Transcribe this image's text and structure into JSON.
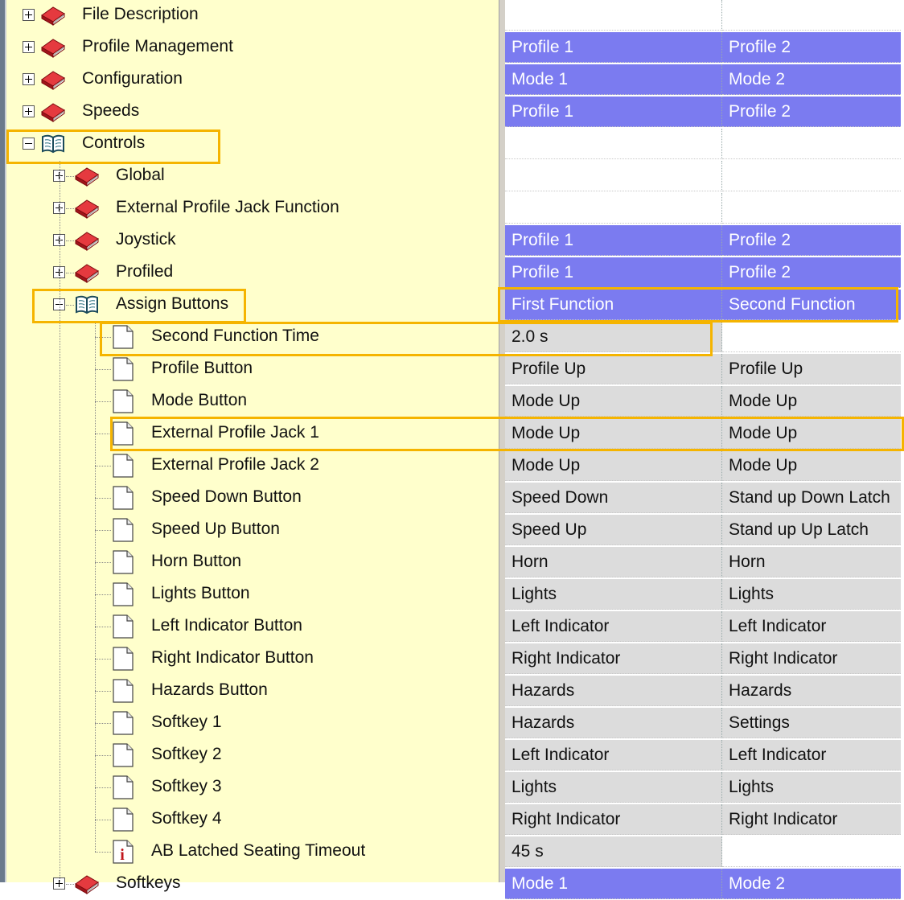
{
  "tree": [
    {
      "label": "File Description",
      "type": "closed-book",
      "expander": "plus",
      "level": 0
    },
    {
      "label": "Profile Management",
      "type": "closed-book",
      "expander": "plus",
      "level": 0,
      "col1": "Profile 1",
      "col2": "Profile 2",
      "style": "blue"
    },
    {
      "label": "Configuration",
      "type": "closed-book",
      "expander": "plus",
      "level": 0,
      "col1": "Mode 1",
      "col2": "Mode 2",
      "style": "blue"
    },
    {
      "label": "Speeds",
      "type": "closed-book",
      "expander": "plus",
      "level": 0,
      "col1": "Profile 1",
      "col2": "Profile 2",
      "style": "blue"
    },
    {
      "label": "Controls",
      "type": "open-book",
      "expander": "minus",
      "level": 0
    },
    {
      "label": "Global",
      "type": "closed-book",
      "expander": "plus",
      "level": 1
    },
    {
      "label": "External Profile Jack Function",
      "type": "closed-book",
      "expander": "plus",
      "level": 1
    },
    {
      "label": "Joystick",
      "type": "closed-book",
      "expander": "plus",
      "level": 1,
      "col1": "Profile 1",
      "col2": "Profile 2",
      "style": "blue"
    },
    {
      "label": "Profiled",
      "type": "closed-book",
      "expander": "plus",
      "level": 1,
      "col1": "Profile 1",
      "col2": "Profile 2",
      "style": "blue"
    },
    {
      "label": "Assign Buttons",
      "type": "open-book",
      "expander": "minus",
      "level": 1,
      "col1": "First Function",
      "col2": "Second Function",
      "style": "blue"
    },
    {
      "label": "Second Function Time",
      "type": "doc",
      "level": 2,
      "col1": "2.0 s",
      "col2": "",
      "style": "gray-white"
    },
    {
      "label": "Profile Button",
      "type": "doc",
      "level": 2,
      "col1": "Profile Up",
      "col2": "Profile Up",
      "style": "gray"
    },
    {
      "label": "Mode Button",
      "type": "doc",
      "level": 2,
      "col1": "Mode Up",
      "col2": "Mode Up",
      "style": "gray"
    },
    {
      "label": "External Profile Jack 1",
      "type": "doc",
      "level": 2,
      "col1": "Mode Up",
      "col2": "Mode Up",
      "style": "gray"
    },
    {
      "label": "External Profile Jack 2",
      "type": "doc",
      "level": 2,
      "col1": "Mode Up",
      "col2": "Mode Up",
      "style": "gray"
    },
    {
      "label": "Speed Down Button",
      "type": "doc",
      "level": 2,
      "col1": "Speed Down",
      "col2": "Stand up Down Latch",
      "style": "gray"
    },
    {
      "label": "Speed Up Button",
      "type": "doc",
      "level": 2,
      "col1": "Speed Up",
      "col2": "Stand up Up Latch",
      "style": "gray"
    },
    {
      "label": "Horn Button",
      "type": "doc",
      "level": 2,
      "col1": "Horn",
      "col2": "Horn",
      "style": "gray"
    },
    {
      "label": "Lights Button",
      "type": "doc",
      "level": 2,
      "col1": "Lights",
      "col2": "Lights",
      "style": "gray"
    },
    {
      "label": "Left Indicator Button",
      "type": "doc",
      "level": 2,
      "col1": "Left Indicator",
      "col2": "Left Indicator",
      "style": "gray"
    },
    {
      "label": "Right Indicator Button",
      "type": "doc",
      "level": 2,
      "col1": "Right Indicator",
      "col2": "Right Indicator",
      "style": "gray"
    },
    {
      "label": "Hazards Button",
      "type": "doc",
      "level": 2,
      "col1": "Hazards",
      "col2": "Hazards",
      "style": "gray"
    },
    {
      "label": "Softkey 1",
      "type": "doc",
      "level": 2,
      "col1": "Hazards",
      "col2": "Settings",
      "style": "gray"
    },
    {
      "label": "Softkey 2",
      "type": "doc",
      "level": 2,
      "col1": "Left Indicator",
      "col2": "Left Indicator",
      "style": "gray"
    },
    {
      "label": "Softkey 3",
      "type": "doc",
      "level": 2,
      "col1": "Lights",
      "col2": "Lights",
      "style": "gray"
    },
    {
      "label": "Softkey 4",
      "type": "doc",
      "level": 2,
      "col1": "Right Indicator",
      "col2": "Right Indicator",
      "style": "gray"
    },
    {
      "label": "AB Latched Seating Timeout",
      "type": "info",
      "level": 2,
      "col1": "45 s",
      "col2": "",
      "style": "gray-white"
    },
    {
      "label": "Softkeys",
      "type": "closed-book",
      "expander": "plus",
      "level": 1,
      "col1": "Mode 1",
      "col2": "Mode 2",
      "style": "blue"
    }
  ],
  "colors": {
    "tree_bg": "#ffffcc",
    "header_blue": "#7b7bf0",
    "value_gray": "#dcdcdc",
    "highlight": "#f5b400",
    "book_red": "#c0161c"
  },
  "highlights": [
    "Controls",
    "Assign Buttons",
    "First Function / Second Function",
    "Second Function Time",
    "External Profile Jack 1"
  ]
}
